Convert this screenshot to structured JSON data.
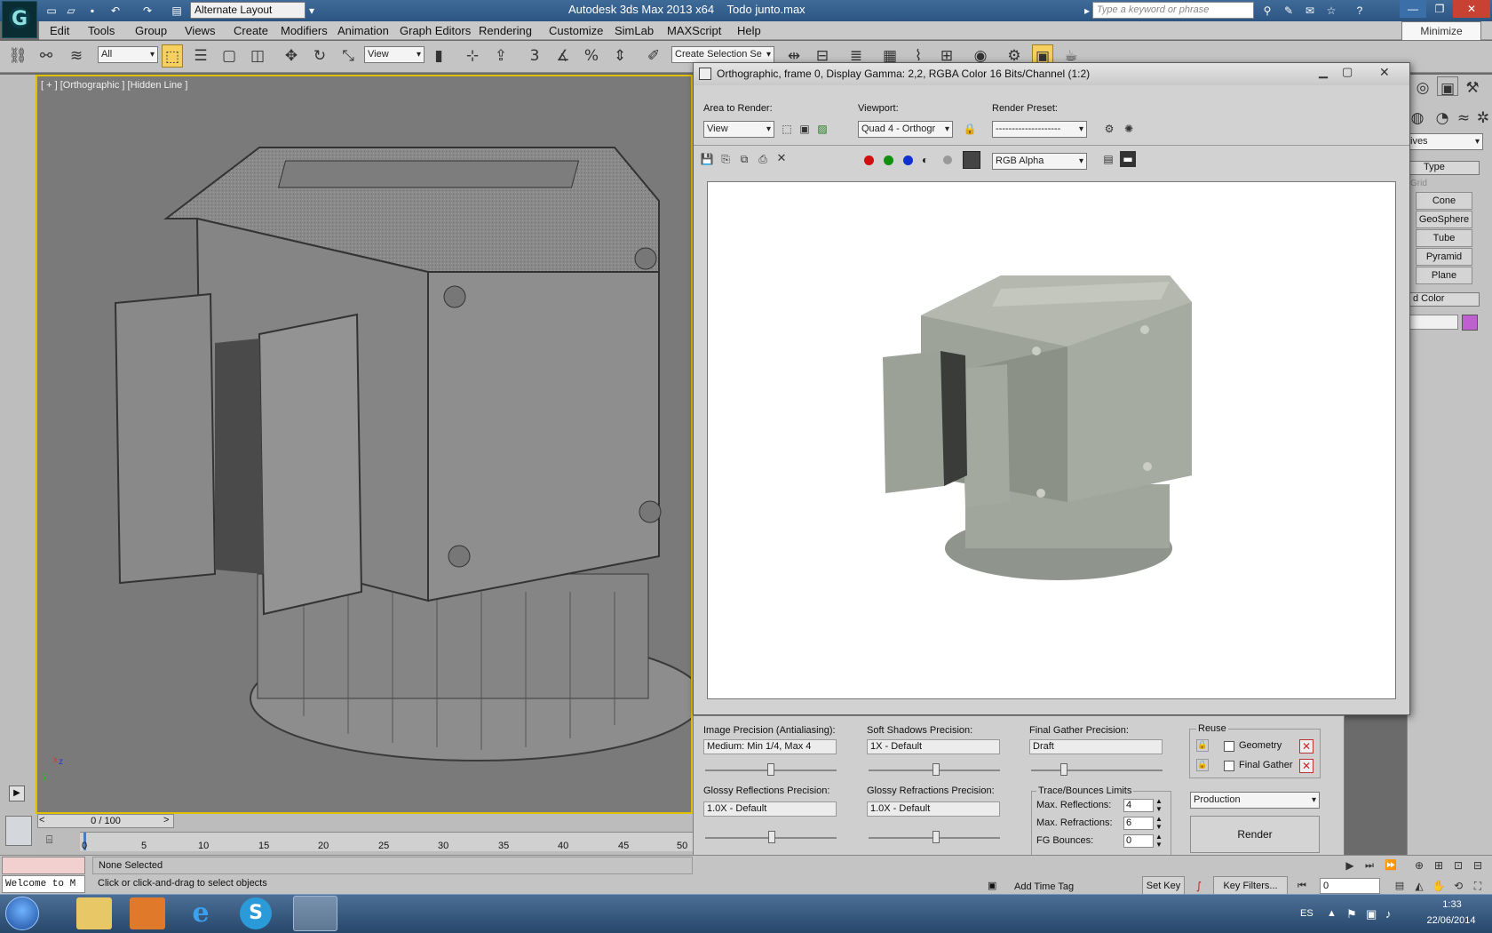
{
  "app": {
    "title": "Autodesk 3ds Max  2013 x64",
    "file": "Todo junto.max",
    "logo": "G",
    "layout": "Alternate Layout",
    "search_placeholder": "Type a keyword or phrase",
    "tooltip": "Minimize"
  },
  "menu": [
    "Edit",
    "Tools",
    "Group",
    "Views",
    "Create",
    "Modifiers",
    "Animation",
    "Graph Editors",
    "Rendering",
    "Customize",
    "SimLab",
    "MAXScript",
    "Help"
  ],
  "toolbar": {
    "filter": "All",
    "ref_coord": "View",
    "named_selection": "Create Selection Se"
  },
  "viewport": {
    "label": "[ + ] [Orthographic ] [Hidden Line ]",
    "axis_x": "x",
    "axis_y": "y",
    "axis_z": "z"
  },
  "render_window": {
    "title": "Orthographic, frame 0, Display Gamma: 2,2, RGBA Color 16 Bits/Channel (1:2)",
    "area_label": "Area to Render:",
    "area_value": "View",
    "viewport_label": "Viewport:",
    "viewport_value": "Quad 4 - Orthogr",
    "preset_label": "Render Preset:",
    "preset_value": "--------------------",
    "channel": "RGB Alpha",
    "channel_colors": {
      "red": "#d01010",
      "green": "#109010",
      "blue": "#1030d0"
    }
  },
  "render_panel": {
    "image_precision_label": "Image Precision (Antialiasing):",
    "image_precision_value": "Medium: Min 1/4, Max 4",
    "soft_shadows_label": "Soft Shadows Precision:",
    "soft_shadows_value": "1X - Default",
    "final_gather_label": "Final Gather Precision:",
    "final_gather_value": "Draft",
    "glossy_reflections_label": "Glossy Reflections Precision:",
    "glossy_reflections_value": "1.0X - Default",
    "glossy_refractions_label": "Glossy Refractions Precision:",
    "glossy_refractions_value": "1.0X - Default",
    "reuse_title": "Reuse",
    "geometry_label": "Geometry",
    "final_gather_cb_label": "Final Gather",
    "trace_title": "Trace/Bounces Limits",
    "max_reflections_label": "Max. Reflections:",
    "max_reflections_value": "4",
    "max_refractions_label": "Max. Refractions:",
    "max_refractions_value": "6",
    "fg_bounces_label": "FG Bounces:",
    "fg_bounces_value": "0",
    "mode_value": "Production",
    "render_button": "Render"
  },
  "command_panel": {
    "dropdown": "ives",
    "rollout_type": "Type",
    "grid_label": "Grid",
    "buttons": [
      "Cone",
      "GeoSphere",
      "Tube",
      "Pyramid",
      "Plane"
    ],
    "name_color": "d Color",
    "swatch_color": "#c060d0"
  },
  "timeline": {
    "frame": "0 / 100",
    "prev": "<",
    "next": ">",
    "ticks": [
      "0",
      "5",
      "10",
      "15",
      "20",
      "25",
      "30",
      "35",
      "40",
      "45",
      "50"
    ]
  },
  "status": {
    "selection": "None Selected",
    "prompt": "Click or click-and-drag to select objects",
    "maxscript": "Welcome to M",
    "add_time_tag": "Add Time Tag",
    "set_key": "Set Key",
    "key_filters": "Key Filters...",
    "frame_field": "0"
  },
  "taskbar": {
    "language": "ES",
    "time": "1:33",
    "date": "22/06/2014"
  }
}
